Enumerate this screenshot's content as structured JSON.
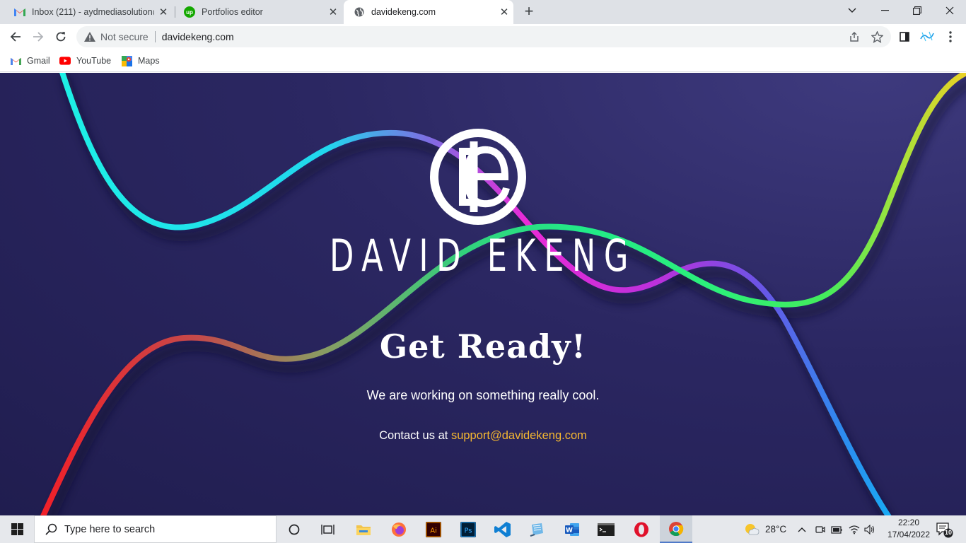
{
  "browser": {
    "tabs": [
      {
        "title": "Inbox (211) - aydmediasolution@",
        "icon": "gmail-icon",
        "active": false
      },
      {
        "title": "Portfolios editor",
        "icon": "upwork-icon",
        "active": false
      },
      {
        "title": "davidekeng.com",
        "icon": "globe-icon",
        "active": true
      }
    ],
    "new_tab": "+",
    "address": {
      "security_label": "Not secure",
      "url": "davidekeng.com"
    },
    "bookmarks": [
      {
        "label": "Gmail",
        "icon": "gmail-icon"
      },
      {
        "label": "YouTube",
        "icon": "youtube-icon"
      },
      {
        "label": "Maps",
        "icon": "maps-icon"
      }
    ]
  },
  "page": {
    "brand_name": "DAVID EKENG",
    "headline": "Get Ready!",
    "tagline": "We are working on something really cool.",
    "contact_prefix": "Contact us at",
    "contact_email": "support@davidekeng.com",
    "colors": {
      "background": "#2b2762",
      "email": "#f5b731"
    }
  },
  "taskbar": {
    "search_placeholder": "Type here to search",
    "apps": [
      "cortana-icon",
      "task-view-icon",
      "file-explorer-icon",
      "firefox-icon",
      "illustrator-icon",
      "photoshop-icon",
      "vscode-icon",
      "notepad-icon",
      "word-icon",
      "terminal-icon",
      "opera-icon",
      "chrome-icon"
    ],
    "weather": "28°C",
    "time": "22:20",
    "date": "17/04/2022",
    "notification_count": "10"
  }
}
